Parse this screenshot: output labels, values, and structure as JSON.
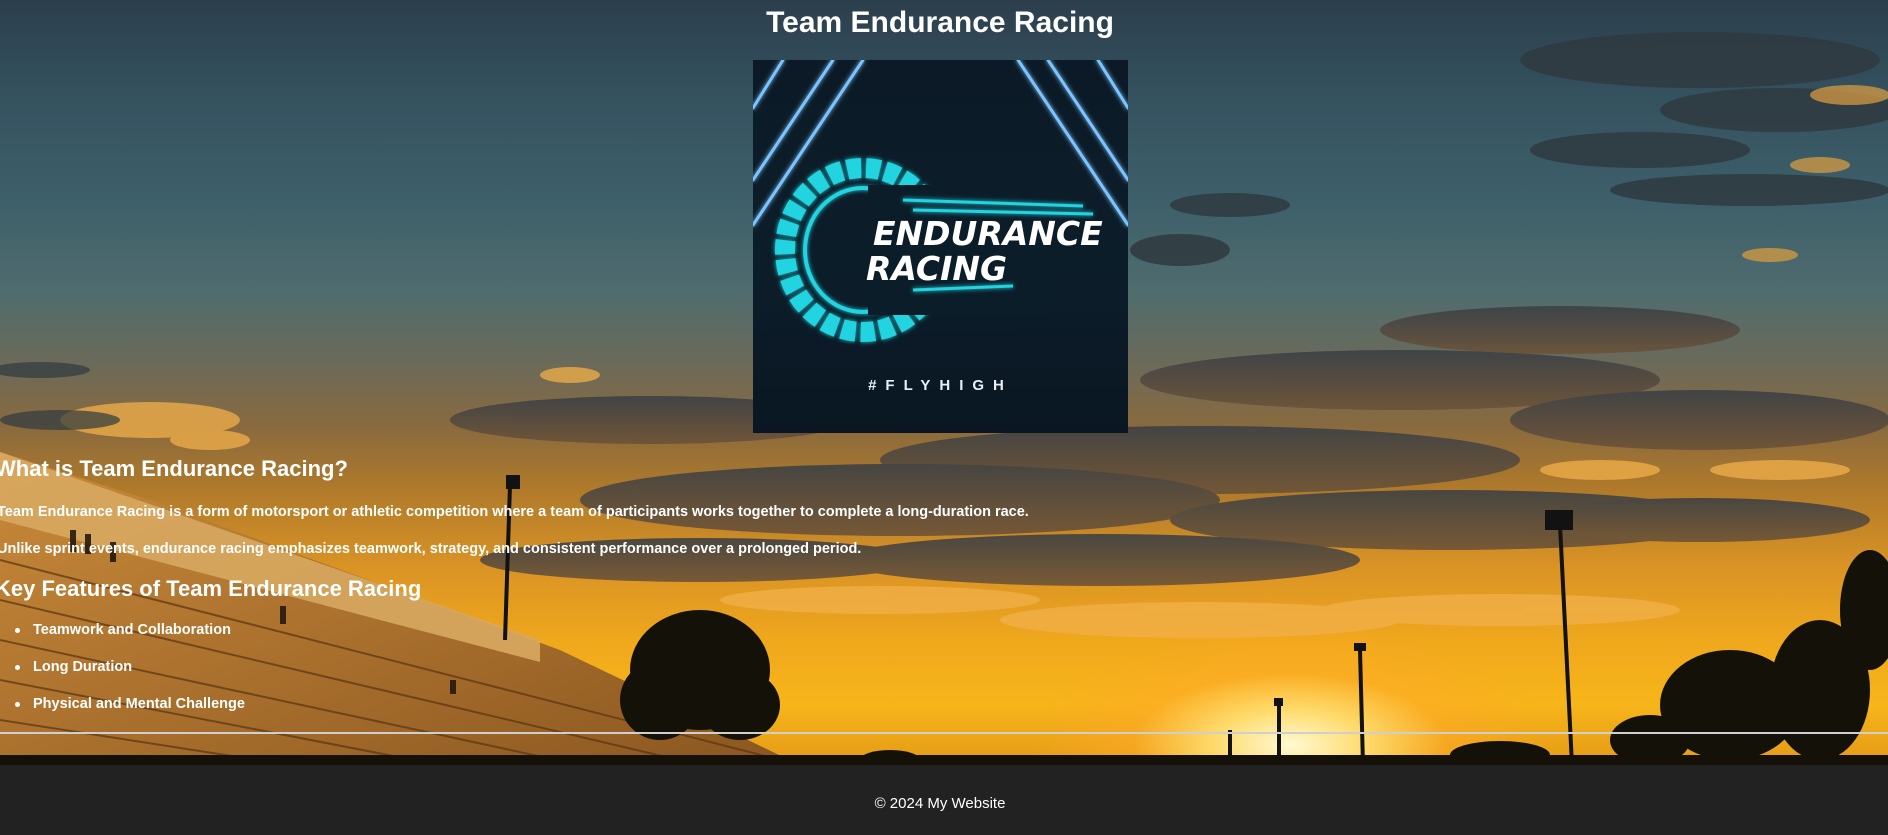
{
  "header": {
    "title": "Team Endurance Racing"
  },
  "logo": {
    "text_line1": "ENDURANCE",
    "text_line2": "RACING",
    "hashtag": "#FLYHIGH",
    "accent_color": "#22d3e0",
    "neon_color": "#4aa8ff"
  },
  "about": {
    "heading": "What is Team Endurance Racing?",
    "paragraphs": [
      "Team Endurance Racing is a form of motorsport or athletic competition where a team of participants works together to complete a long-duration race.",
      "Unlike sprint events, endurance racing emphasizes teamwork, strategy, and consistent performance over a prolonged period."
    ]
  },
  "features": {
    "heading": "Key Features of Team Endurance Racing",
    "items": [
      "Teamwork and Collaboration",
      "Long Duration",
      "Physical and Mental Challenge"
    ]
  },
  "footer": {
    "text": "© 2024 My Website",
    "background": "#222222"
  }
}
